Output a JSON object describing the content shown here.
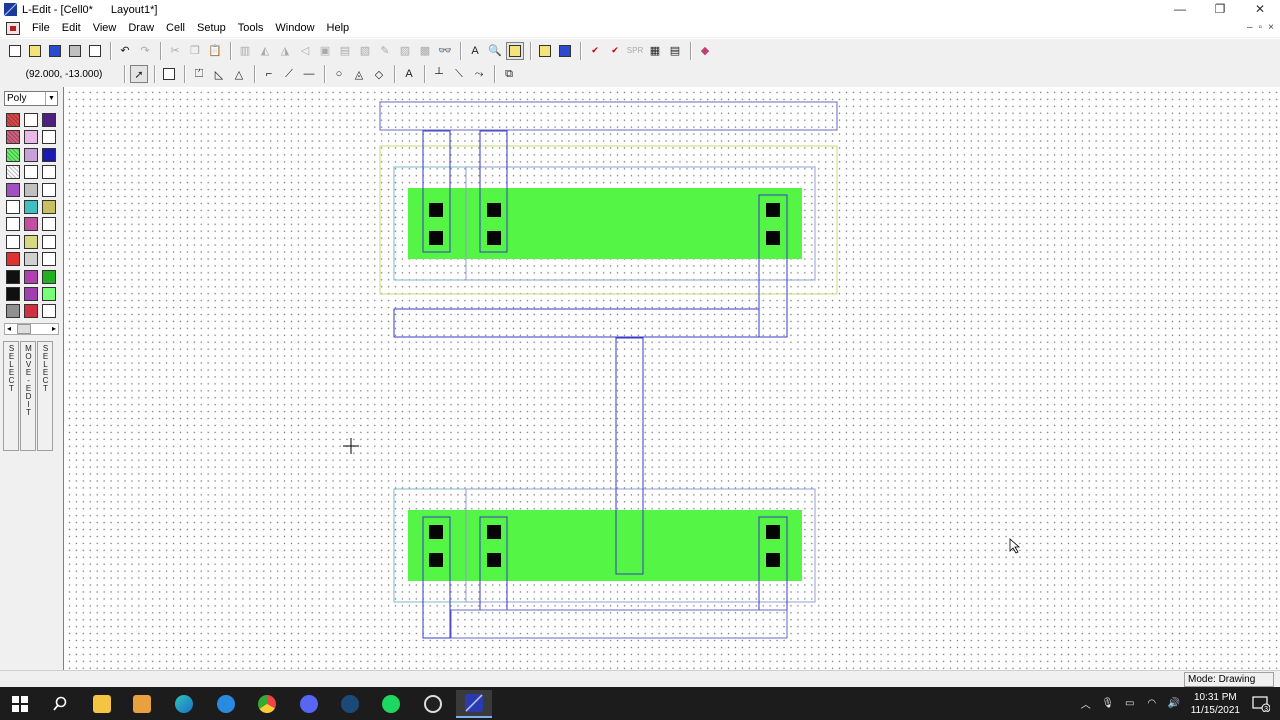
{
  "window": {
    "app_name": "L-Edit",
    "title_cell": "L-Edit - [Cell0*",
    "title_file": "Layout1*]",
    "controls": [
      "—",
      "❐",
      "✕"
    ]
  },
  "menu": {
    "items": [
      "File",
      "Edit",
      "View",
      "Draw",
      "Cell",
      "Setup",
      "Tools",
      "Window",
      "Help"
    ],
    "mdi_controls": [
      "–",
      "▫",
      "×"
    ]
  },
  "toolbar": {
    "coordinates": "(92.000, -13.000)"
  },
  "palette": {
    "layer_selected": "Poly",
    "swatch_colors": [
      "#d84848",
      "#ffffff",
      "#502080",
      "#d06080",
      "#e8b8e8",
      "#ffffff",
      "#66ee66",
      "#c8a0d8",
      "#1a1ab0",
      "#ffffff",
      "#ffffff",
      "#ffffff",
      "#a050c0",
      "#c0c0c0",
      "#ffffff",
      "#ffffff",
      "#40c0c0",
      "#c8c060",
      "#ffffff",
      "#c050a0",
      "#ffffff",
      "#ffffff",
      "#d8d880",
      "#ffffff",
      "#e03030",
      "#d0d0d0",
      "#ffffff",
      "#101010",
      "#b040b0",
      "#20b020",
      "#101010",
      "#a040b0",
      "#77ff77",
      "#909090",
      "#d03040",
      "#ffffff"
    ],
    "mode_buttons": [
      "SELECT",
      "MOVE-EDIT",
      "SELECT"
    ]
  },
  "layout": {
    "colors": {
      "active": "#55f545",
      "contact": "#050505",
      "poly": "#3a3acb",
      "metal": "#6464c8",
      "select_outline": "#8fa0d0",
      "nwell": "#c8d878",
      "diff_outline": "#7fb8c8"
    }
  },
  "statusbar": {
    "mode": "Mode: Drawing"
  },
  "taskbar": {
    "apps": [
      "windows-start",
      "search",
      "file-explorer",
      "media-player",
      "edge",
      "internet-explorer",
      "chrome",
      "discord",
      "steam",
      "spotify",
      "obs",
      "l-edit"
    ],
    "time": "10:31 PM",
    "date": "11/15/2021",
    "notification_count": "3"
  }
}
